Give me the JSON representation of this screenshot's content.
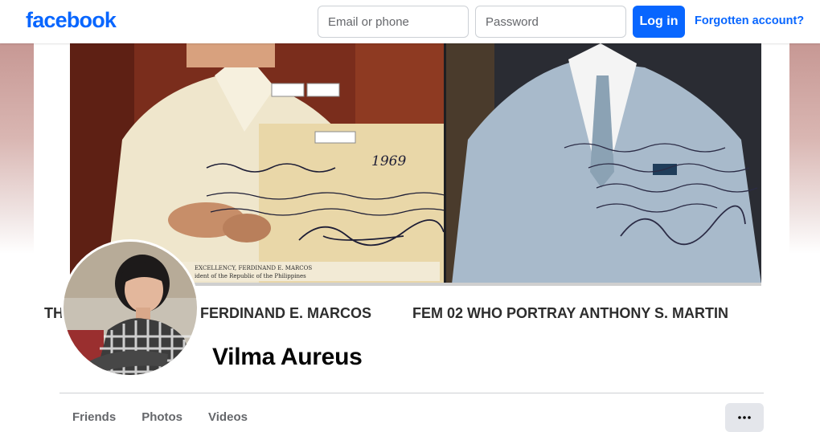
{
  "header": {
    "logo_text": "facebook",
    "email_placeholder": "Email or phone",
    "password_placeholder": "Password",
    "login_label": "Log in",
    "forgot_label": "Forgotten account?"
  },
  "cover": {
    "caption_left_partial": "TH",
    "caption_left": "FERDINAND E. MARCOS",
    "caption_right": "FEM 02 WHO PORTRAY ANTHONY S. MARTIN",
    "handwritten_year": "1969",
    "plaque_line1": "EXCELLENCY, FERDINAND E. MARCOS",
    "plaque_line2": "ident of the Republic of the Philippines"
  },
  "profile": {
    "name": "Vilma Aureus"
  },
  "tabs": [
    {
      "label": "Friends"
    },
    {
      "label": "Photos"
    },
    {
      "label": "Videos"
    }
  ],
  "more_icon": "ellipsis-icon",
  "colors": {
    "brand": "#0866ff",
    "tab_text": "#65676b",
    "name_text": "#050505",
    "more_button_bg": "#e4e6eb"
  }
}
